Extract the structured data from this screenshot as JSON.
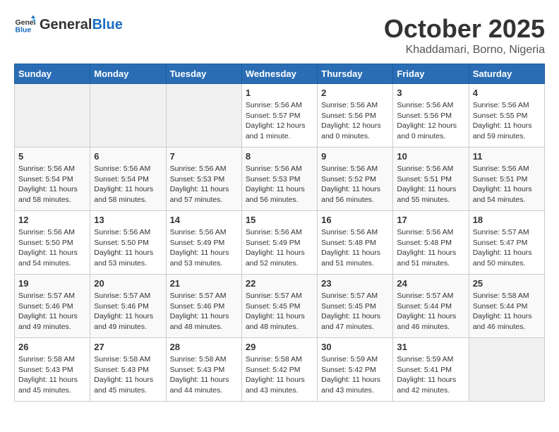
{
  "header": {
    "logo_general": "General",
    "logo_blue": "Blue",
    "month_title": "October 2025",
    "location": "Khaddamari, Borno, Nigeria"
  },
  "weekdays": [
    "Sunday",
    "Monday",
    "Tuesday",
    "Wednesday",
    "Thursday",
    "Friday",
    "Saturday"
  ],
  "weeks": [
    [
      {
        "day": "",
        "empty": true
      },
      {
        "day": "",
        "empty": true
      },
      {
        "day": "",
        "empty": true
      },
      {
        "day": "1",
        "sunrise": "5:56 AM",
        "sunset": "5:57 PM",
        "daylight": "12 hours and 1 minute."
      },
      {
        "day": "2",
        "sunrise": "5:56 AM",
        "sunset": "5:56 PM",
        "daylight": "12 hours and 0 minutes."
      },
      {
        "day": "3",
        "sunrise": "5:56 AM",
        "sunset": "5:56 PM",
        "daylight": "12 hours and 0 minutes."
      },
      {
        "day": "4",
        "sunrise": "5:56 AM",
        "sunset": "5:55 PM",
        "daylight": "11 hours and 59 minutes."
      }
    ],
    [
      {
        "day": "5",
        "sunrise": "5:56 AM",
        "sunset": "5:54 PM",
        "daylight": "11 hours and 58 minutes."
      },
      {
        "day": "6",
        "sunrise": "5:56 AM",
        "sunset": "5:54 PM",
        "daylight": "11 hours and 58 minutes."
      },
      {
        "day": "7",
        "sunrise": "5:56 AM",
        "sunset": "5:53 PM",
        "daylight": "11 hours and 57 minutes."
      },
      {
        "day": "8",
        "sunrise": "5:56 AM",
        "sunset": "5:53 PM",
        "daylight": "11 hours and 56 minutes."
      },
      {
        "day": "9",
        "sunrise": "5:56 AM",
        "sunset": "5:52 PM",
        "daylight": "11 hours and 56 minutes."
      },
      {
        "day": "10",
        "sunrise": "5:56 AM",
        "sunset": "5:51 PM",
        "daylight": "11 hours and 55 minutes."
      },
      {
        "day": "11",
        "sunrise": "5:56 AM",
        "sunset": "5:51 PM",
        "daylight": "11 hours and 54 minutes."
      }
    ],
    [
      {
        "day": "12",
        "sunrise": "5:56 AM",
        "sunset": "5:50 PM",
        "daylight": "11 hours and 54 minutes."
      },
      {
        "day": "13",
        "sunrise": "5:56 AM",
        "sunset": "5:50 PM",
        "daylight": "11 hours and 53 minutes."
      },
      {
        "day": "14",
        "sunrise": "5:56 AM",
        "sunset": "5:49 PM",
        "daylight": "11 hours and 53 minutes."
      },
      {
        "day": "15",
        "sunrise": "5:56 AM",
        "sunset": "5:49 PM",
        "daylight": "11 hours and 52 minutes."
      },
      {
        "day": "16",
        "sunrise": "5:56 AM",
        "sunset": "5:48 PM",
        "daylight": "11 hours and 51 minutes."
      },
      {
        "day": "17",
        "sunrise": "5:56 AM",
        "sunset": "5:48 PM",
        "daylight": "11 hours and 51 minutes."
      },
      {
        "day": "18",
        "sunrise": "5:57 AM",
        "sunset": "5:47 PM",
        "daylight": "11 hours and 50 minutes."
      }
    ],
    [
      {
        "day": "19",
        "sunrise": "5:57 AM",
        "sunset": "5:46 PM",
        "daylight": "11 hours and 49 minutes."
      },
      {
        "day": "20",
        "sunrise": "5:57 AM",
        "sunset": "5:46 PM",
        "daylight": "11 hours and 49 minutes."
      },
      {
        "day": "21",
        "sunrise": "5:57 AM",
        "sunset": "5:46 PM",
        "daylight": "11 hours and 48 minutes."
      },
      {
        "day": "22",
        "sunrise": "5:57 AM",
        "sunset": "5:45 PM",
        "daylight": "11 hours and 48 minutes."
      },
      {
        "day": "23",
        "sunrise": "5:57 AM",
        "sunset": "5:45 PM",
        "daylight": "11 hours and 47 minutes."
      },
      {
        "day": "24",
        "sunrise": "5:57 AM",
        "sunset": "5:44 PM",
        "daylight": "11 hours and 46 minutes."
      },
      {
        "day": "25",
        "sunrise": "5:58 AM",
        "sunset": "5:44 PM",
        "daylight": "11 hours and 46 minutes."
      }
    ],
    [
      {
        "day": "26",
        "sunrise": "5:58 AM",
        "sunset": "5:43 PM",
        "daylight": "11 hours and 45 minutes."
      },
      {
        "day": "27",
        "sunrise": "5:58 AM",
        "sunset": "5:43 PM",
        "daylight": "11 hours and 45 minutes."
      },
      {
        "day": "28",
        "sunrise": "5:58 AM",
        "sunset": "5:43 PM",
        "daylight": "11 hours and 44 minutes."
      },
      {
        "day": "29",
        "sunrise": "5:58 AM",
        "sunset": "5:42 PM",
        "daylight": "11 hours and 43 minutes."
      },
      {
        "day": "30",
        "sunrise": "5:59 AM",
        "sunset": "5:42 PM",
        "daylight": "11 hours and 43 minutes."
      },
      {
        "day": "31",
        "sunrise": "5:59 AM",
        "sunset": "5:41 PM",
        "daylight": "11 hours and 42 minutes."
      },
      {
        "day": "",
        "empty": true
      }
    ]
  ],
  "labels": {
    "sunrise": "Sunrise:",
    "sunset": "Sunset:",
    "daylight": "Daylight hours"
  }
}
